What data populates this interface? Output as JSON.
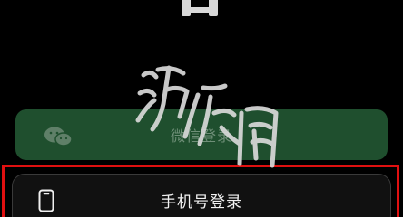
{
  "login": {
    "wechat_label": "微信登录",
    "phone_label": "手机号登录"
  },
  "icons": {
    "wechat": "wechat-icon",
    "phone": "phone-icon",
    "logo": "app-logo-icon"
  },
  "watermark_text": "游侠网",
  "colors": {
    "background": "#000000",
    "wechat_button": "#1f4f2e",
    "phone_button": "#111111",
    "highlight": "#e01010"
  }
}
